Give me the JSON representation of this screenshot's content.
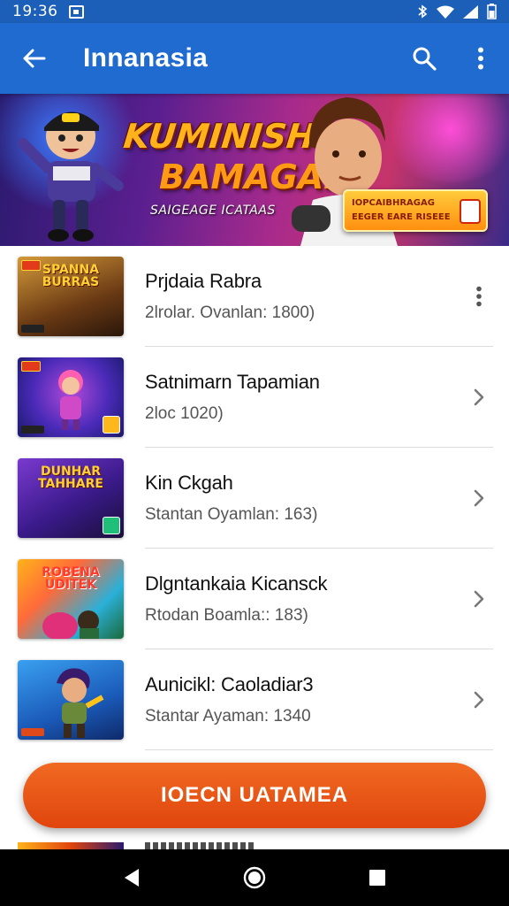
{
  "status_bar": {
    "time": "19:36",
    "icons": [
      "notification-icon",
      "bluetooth-icon",
      "wifi-icon",
      "signal-icon",
      "battery-icon"
    ]
  },
  "app_bar": {
    "title": "Innanasia",
    "back_icon": "arrow-left-icon",
    "search_icon": "search-icon",
    "menu_icon": "more-vert-icon",
    "color": "#1f6bd0"
  },
  "banner": {
    "title_line1": "KUMINISH",
    "title_line2": "BAMAGAI",
    "subtitle": "SAIGEAGE ICATAAS",
    "promo_line1": "IOPCAIBHRAGAG",
    "promo_line2": "EEGER EARE RISEEE"
  },
  "list": {
    "items": [
      {
        "title": "Prjdaia Rabra",
        "subtitle": "2lrolar. Ovanlan: 1800)",
        "thumb_label": "SPANNA BURRAS",
        "action_icon": "more-vert-icon",
        "thumb_colors": [
          "#c8862a",
          "#3a2412"
        ]
      },
      {
        "title": "Satnimarn Tapamian",
        "subtitle": "2loc 1020)",
        "thumb_label": "",
        "action_icon": "chevron-right-icon",
        "thumb_colors": [
          "#3b55d8",
          "#7a2fa8"
        ]
      },
      {
        "title": "Kin Ckgah",
        "subtitle": "Stantan Oyamlan: 163)",
        "thumb_label": "DUNHAR TAHHARE",
        "action_icon": "chevron-right-icon",
        "thumb_colors": [
          "#6a2fb8",
          "#2a1a5e"
        ]
      },
      {
        "title": "Dlgntankaia Kicansck",
        "subtitle": "Rtodan Boamla:: 183)",
        "thumb_label": "ROBENA UDITEK",
        "action_icon": "chevron-right-icon",
        "thumb_colors": [
          "#f0a020",
          "#d43a6a"
        ]
      },
      {
        "title": "Aunicikl: Caoladiar3",
        "subtitle": "Stantar Ayaman: 1340",
        "thumb_label": "",
        "action_icon": "chevron-right-icon",
        "thumb_colors": [
          "#2a8ad8",
          "#1a4a9a"
        ]
      }
    ]
  },
  "fab": {
    "label": "IOECN UATAMEA",
    "color": "#e8520f"
  },
  "nav_bar": {
    "back_icon": "nav-back-icon",
    "home_icon": "nav-home-icon",
    "recents_icon": "nav-recents-icon"
  }
}
